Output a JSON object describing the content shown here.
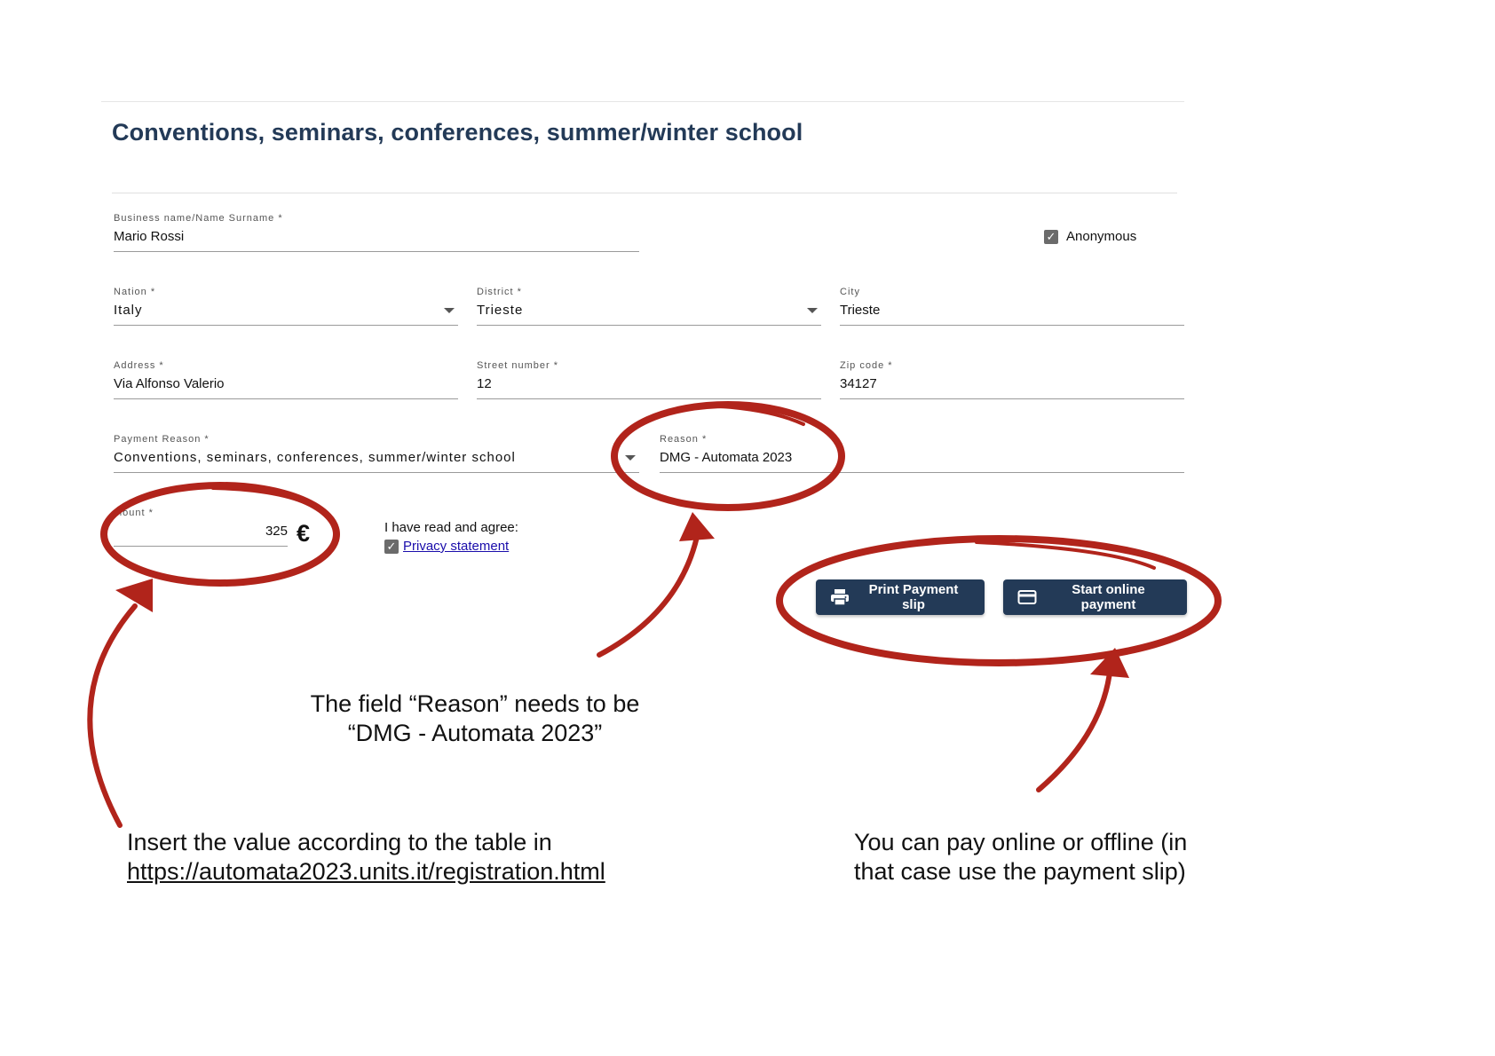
{
  "page": {
    "title": "Conventions, seminars, conferences, summer/winter school"
  },
  "form": {
    "name": {
      "label": "Business name/Name Surname *",
      "value": "Mario Rossi"
    },
    "anonymous": {
      "label": "Anonymous",
      "checked": true
    },
    "nation": {
      "label": "Nation *",
      "value": "Italy"
    },
    "district": {
      "label": "District *",
      "value": "Trieste"
    },
    "city": {
      "label": "City",
      "value": "Trieste"
    },
    "address": {
      "label": "Address *",
      "value": "Via Alfonso Valerio"
    },
    "street_number": {
      "label": "Street number *",
      "value": "12"
    },
    "zip": {
      "label": "Zip code *",
      "value": "34127"
    },
    "payment_reason": {
      "label": "Payment Reason *",
      "value": "Conventions, seminars, conferences, summer/winter school"
    },
    "reason": {
      "label": "Reason *",
      "value": "DMG - Automata 2023"
    },
    "amount": {
      "label": "mount *",
      "value": "325",
      "currency": "€"
    },
    "agree": {
      "text": "I have read and agree:",
      "link": "Privacy statement",
      "checked": true
    }
  },
  "buttons": {
    "print": "Print Payment slip",
    "online": "Start online payment"
  },
  "annotations": {
    "reason_note": [
      "The field “Reason” needs to be",
      "“DMG - Automata 2023”"
    ],
    "amount_note": [
      "Insert the value according to the table in",
      "https://automata2023.units.it/registration.html"
    ],
    "pay_note": [
      "You can pay online or offline (in",
      "that case use the payment slip)"
    ],
    "color": "#b1241b"
  },
  "icons": [
    "checkbox-checked-icon",
    "dropdown-caret-icon",
    "printer-icon",
    "credit-card-icon"
  ]
}
